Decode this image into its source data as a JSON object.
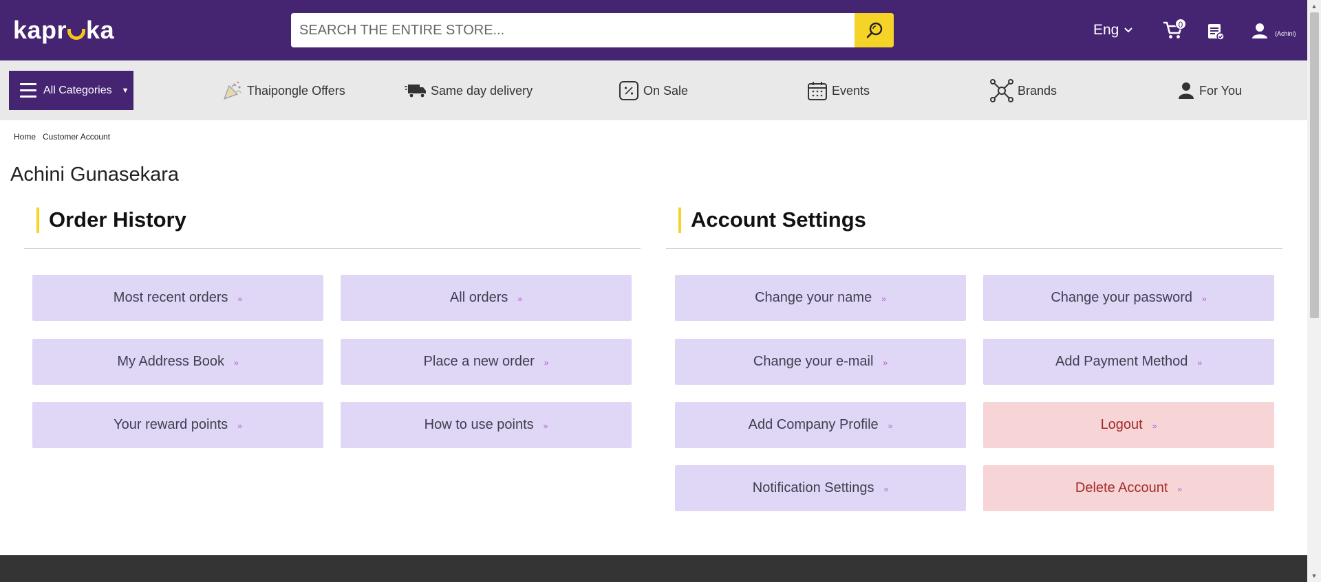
{
  "header": {
    "logo_text_left": "kapr",
    "logo_text_right": "ka",
    "search_placeholder": "SEARCH THE ENTIRE STORE...",
    "language": "Eng",
    "cart_count": "0",
    "user_label": "(Achini)",
    "icons": {
      "search": "search-icon",
      "cart": "cart-icon",
      "orders": "order-list-icon",
      "user": "user-icon",
      "chevron": "chevron-down-icon"
    },
    "colors": {
      "brand": "#452472",
      "accent": "#f5d327"
    }
  },
  "nav": {
    "all_categories": "All Categories",
    "items": [
      {
        "label": "Thaipongle Offers",
        "icon": "party-popper-icon"
      },
      {
        "label": "Same day delivery",
        "icon": "delivery-truck-icon"
      },
      {
        "label": "On Sale",
        "icon": "percent-tag-icon"
      },
      {
        "label": "Events",
        "icon": "calendar-icon"
      },
      {
        "label": "Brands",
        "icon": "network-hub-icon"
      },
      {
        "label": "For You",
        "icon": "person-icon"
      }
    ]
  },
  "breadcrumb": {
    "home": "Home",
    "current": "Customer Account"
  },
  "customer_name": "Achini Gunasekara",
  "order_history": {
    "title": "Order History",
    "buttons": [
      "Most recent orders",
      "All orders",
      "My Address Book",
      "Place a new order",
      "Your reward points",
      "How to use points"
    ]
  },
  "account_settings": {
    "title": "Account Settings",
    "buttons": [
      "Change your name",
      "Change your password",
      "Change your e-mail",
      "Add Payment Method",
      "Add Company Profile",
      "Logout",
      "Notification Settings",
      "Delete Account"
    ]
  },
  "colors": {
    "button_purple": "#e0d6f6",
    "button_red": "#f7d5d7",
    "footer": "#343434"
  }
}
